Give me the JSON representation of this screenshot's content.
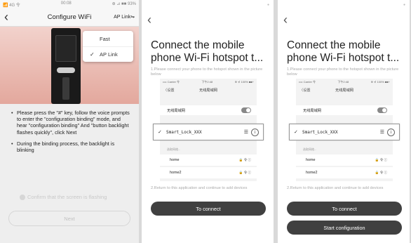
{
  "panel1": {
    "status": {
      "left": "📶 4G 令",
      "time": "00:08",
      "right": "⊕ ⊿ ■■ 93%"
    },
    "title": "Configure WiFi",
    "ap_link_label": "AP Link",
    "menu": {
      "items": [
        {
          "label": "Fast",
          "checked": false
        },
        {
          "label": "AP Link",
          "checked": true
        }
      ]
    },
    "instructions": [
      "Please press the \"#\" key, follow the voice prompts to enter the \"configuration binding\" mode, and hear \"configuration binding\" And \"button backlight flashes quickly\", click Next",
      "During the binding process, the backlight is blinking"
    ],
    "confirm_label": "Confirm that the screen is flashing",
    "next_label": "Next"
  },
  "connect_screen": {
    "heading": "Connect the mobile phone Wi-Fi hotspot t...",
    "step1": "1.Please connect your phone to the hotspot shown in the picture below",
    "step2": "2.Return to this application and continue to add devices",
    "connect_label": "To connect",
    "start_label": "Start configuration",
    "illustration": {
      "status_left": "•••• Carrier 令",
      "status_time": "下午2:48",
      "status_right": "⊕ ⊀ 100% ■■+",
      "back_label": "〈设置",
      "nav_title": "无线局域网",
      "wlan_label": "无线局域网",
      "check": "✓",
      "ssid": "Smart_Lock_XXX",
      "select_label": "选取网络...",
      "networks": [
        "home",
        "home2"
      ],
      "network_icons": "🔒 令 ⓘ"
    }
  }
}
